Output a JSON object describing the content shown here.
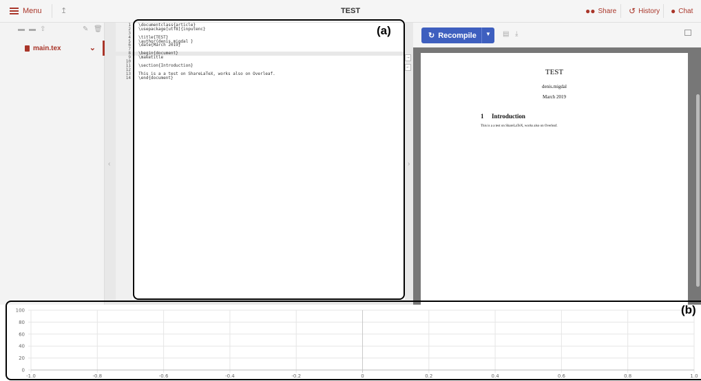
{
  "topbar": {
    "menu_label": "Menu",
    "title": "TEST",
    "share_label": "Share",
    "history_label": "History",
    "chat_label": "Chat",
    "accent": "#a93529"
  },
  "filetree": {
    "files": [
      {
        "name": "main.tex",
        "selected": true
      }
    ]
  },
  "editor": {
    "tag": "(a)",
    "active_line": 8,
    "lines": [
      {
        "n": "1",
        "code": "\\documentclass{article}"
      },
      {
        "n": "2",
        "code": "\\usepackage[utf8]{inputenc}"
      },
      {
        "n": "3",
        "code": ""
      },
      {
        "n": "4",
        "code": "\\title{TEST}"
      },
      {
        "n": "5",
        "code": "\\author{denis.migdal }"
      },
      {
        "n": "6",
        "code": "\\date{March 2019}"
      },
      {
        "n": "7",
        "code": ""
      },
      {
        "n": "8",
        "code": "\\begin{document}"
      },
      {
        "n": "9",
        "code": "\\maketitle"
      },
      {
        "n": "10",
        "code": ""
      },
      {
        "n": "11",
        "code": "\\section{Introduction}"
      },
      {
        "n": "12",
        "code": ""
      },
      {
        "n": "13",
        "code": "This is a a test on ShareLaTeX, works also on Overleaf."
      },
      {
        "n": "14",
        "code": "\\end{document}"
      }
    ]
  },
  "pdf": {
    "recompile_label": "Recompile",
    "button_color": "#3e5fbf",
    "doc_title": "TEST",
    "doc_author": "denis.migdal",
    "doc_date": "March 2019",
    "section_number": "1",
    "section_title": "Introduction",
    "body": "This is a a test on ShareLaTeX, works also on Overleaf."
  },
  "chart": {
    "tag": "(b)"
  },
  "chart_data": {
    "type": "line",
    "title": "",
    "xlabel": "",
    "ylabel": "",
    "xlim": [
      -1.0,
      1.0
    ],
    "ylim": [
      0,
      100
    ],
    "x_ticks": [
      "-1.0",
      "-0.8",
      "-0.6",
      "-0.4",
      "-0.2",
      "0",
      "0.2",
      "0.4",
      "0.6",
      "0.8",
      "1.0"
    ],
    "y_ticks": [
      "0",
      "20",
      "40",
      "60",
      "80",
      "100"
    ],
    "grid": true,
    "series": []
  }
}
